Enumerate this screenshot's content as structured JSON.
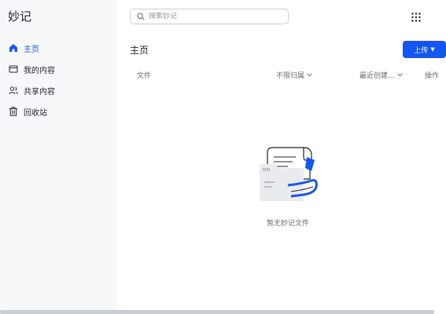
{
  "app": {
    "title": "妙记"
  },
  "sidebar": {
    "items": [
      {
        "label": "主页",
        "icon": "home-icon",
        "active": true
      },
      {
        "label": "我的内容",
        "icon": "folder-icon",
        "active": false
      },
      {
        "label": "共享内容",
        "icon": "shared-users-icon",
        "active": false
      },
      {
        "label": "回收站",
        "icon": "trash-icon",
        "active": false
      }
    ]
  },
  "search": {
    "placeholder": "搜索妙记"
  },
  "header": {
    "apps_icon": "grid-dots-icon"
  },
  "main": {
    "title": "主页",
    "upload_label": "上传",
    "columns": {
      "file": "文件",
      "owner_filter": "不限归属",
      "sort": "最近创建...",
      "actions": "操作"
    },
    "empty_text": "暂无妙记文件"
  },
  "colors": {
    "accent": "#1456f0",
    "sidebar_bg": "#f7f8fa",
    "text_secondary": "#646a73"
  }
}
